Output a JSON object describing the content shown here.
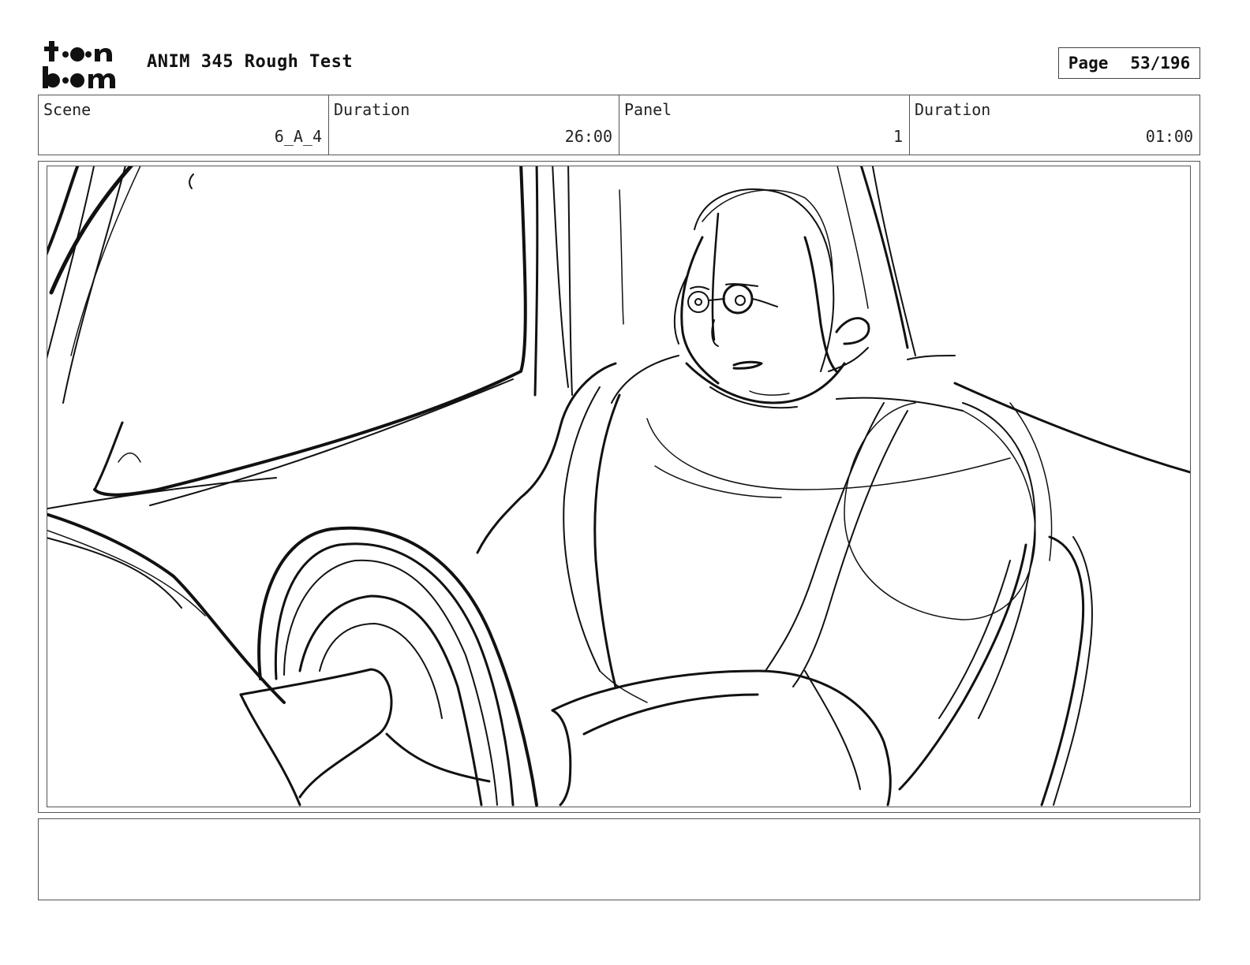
{
  "header": {
    "logo_text": "toon boom",
    "title": "ANIM 345 Rough Test",
    "page_label": "Page",
    "page_value": "53/196"
  },
  "info": {
    "scene_label": "Scene",
    "scene_value": "6_A_4",
    "scene_duration_label": "Duration",
    "scene_duration_value": "26:00",
    "panel_label": "Panel",
    "panel_value": "1",
    "panel_duration_label": "Duration",
    "panel_duration_value": "01:00"
  },
  "panel": {
    "image_name": "rough-sketch-driver-in-car"
  },
  "notes": {
    "text": ""
  }
}
